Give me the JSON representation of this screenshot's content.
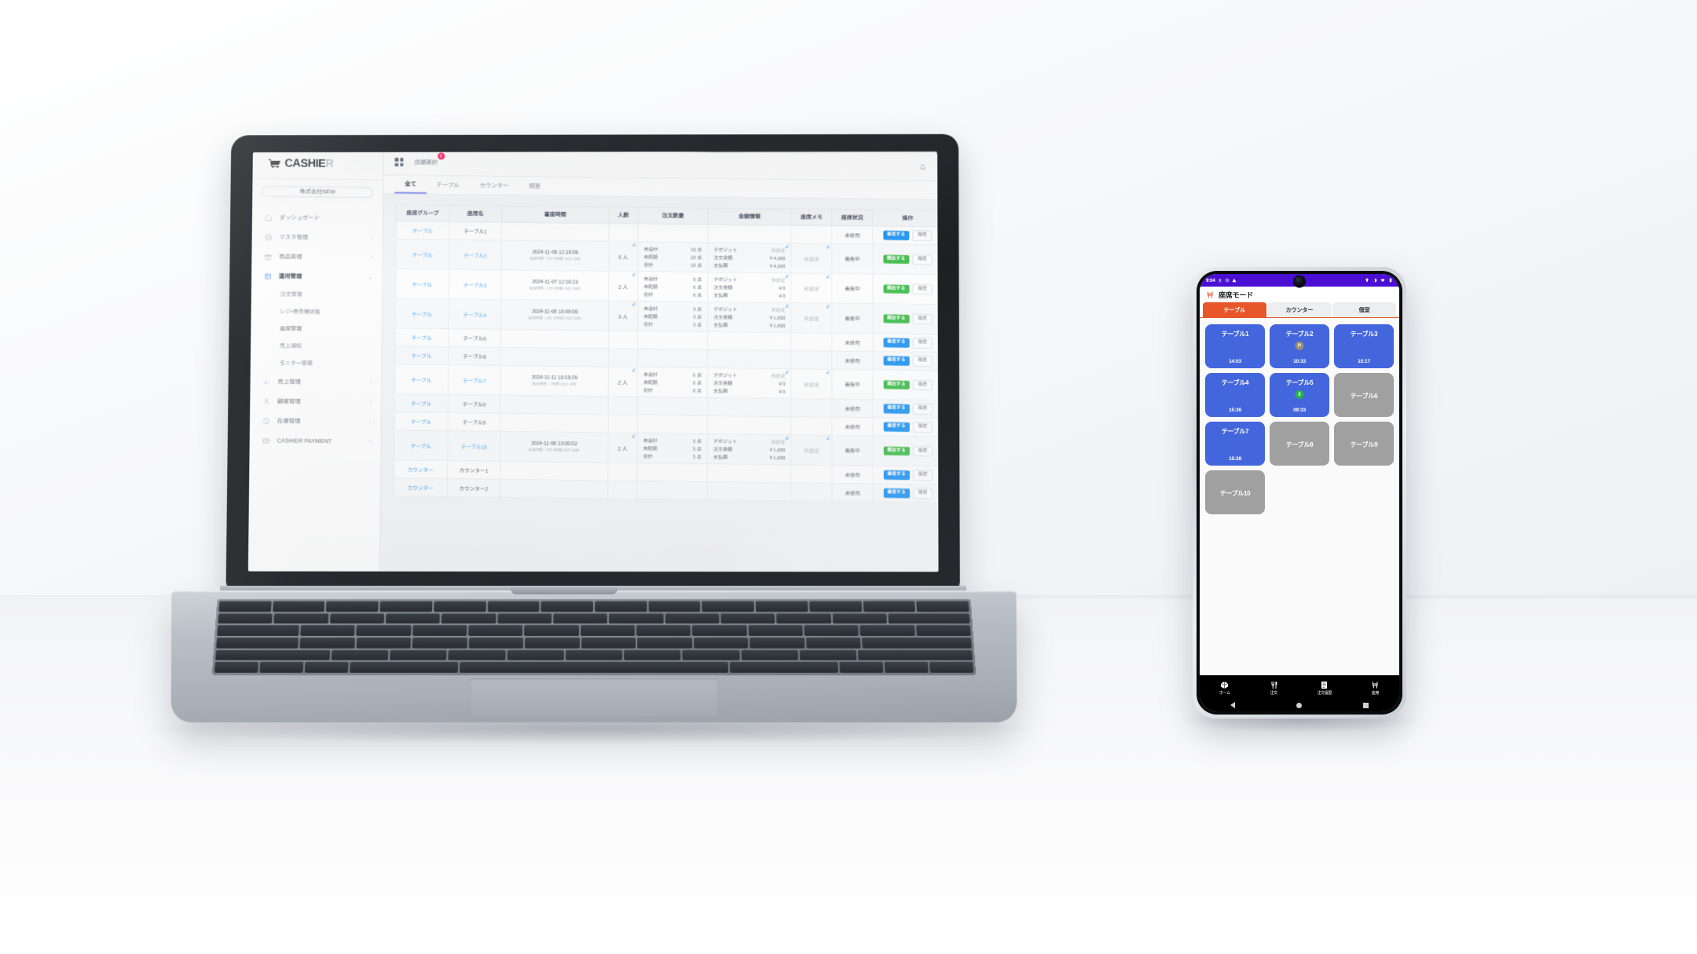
{
  "desktop": {
    "brand": {
      "name_bold": "CASHIE",
      "name_dim": "R",
      "logo_icon": "shopping-cart-icon"
    },
    "company_selector": "株式会社NEW",
    "topbar": {
      "apps_icon": "grid-apps-icon",
      "shop_select_label": "店舗選択",
      "shop_select_badge": "3",
      "bell_icon": "bell-icon",
      "gear_icon": "gear-icon"
    },
    "sidebar": {
      "items": [
        {
          "label": "ダッシュボード",
          "icon": "home-icon",
          "chevron": "",
          "active": false
        },
        {
          "label": "マスタ管理",
          "icon": "database-icon",
          "chevron": "›",
          "active": false
        },
        {
          "label": "商品管理",
          "icon": "box-icon",
          "chevron": "›",
          "active": false
        },
        {
          "label": "運用管理",
          "icon": "window-icon",
          "chevron": "⌄",
          "active": true
        }
      ],
      "sub_items": [
        {
          "label": "注文管理"
        },
        {
          "label": "レジ・券売機状態"
        },
        {
          "label": "座席管理"
        },
        {
          "label": "売上通知"
        },
        {
          "label": "モニター管理"
        }
      ],
      "items_lower": [
        {
          "label": "売上管理",
          "icon": "chart-icon",
          "chevron": "›"
        },
        {
          "label": "顧客管理",
          "icon": "user-icon",
          "chevron": "›"
        },
        {
          "label": "在庫管理",
          "icon": "clock-icon",
          "chevron": "›"
        },
        {
          "label": "CASHIER PAYMENT",
          "icon": "card-icon",
          "chevron": "›"
        }
      ]
    },
    "tabs": [
      {
        "label": "全て",
        "active": true
      },
      {
        "label": "テーブル",
        "active": false
      },
      {
        "label": "カウンター",
        "active": false
      },
      {
        "label": "個室",
        "active": false
      }
    ],
    "table": {
      "headers": [
        "座席グループ",
        "座席名",
        "着座時間",
        "人数",
        "注文数量",
        "金額情報",
        "座席メモ",
        "座席状況",
        "操作"
      ],
      "qty_labels": [
        "未会計",
        "未配膳",
        "合計"
      ],
      "amount_labels": [
        "デポジット",
        "注文金額",
        "支払額"
      ],
      "unit_points": "点",
      "rows": [
        {
          "group": "テーブル",
          "name": "テーブル1",
          "time": "",
          "time_sub": "",
          "people": "",
          "qty": [],
          "amount": [],
          "memo": "",
          "status": "未使用",
          "action_primary": "着席する",
          "action_primary_color": "blue",
          "action_secondary": "履歴"
        },
        {
          "group": "テーブル",
          "name": "テーブル2",
          "time": "2024-11-06 12:19:06",
          "time_sub": "経過時間：5日 6時間 16分 55秒",
          "people": "5 人",
          "qty": [
            "10 点",
            "10 点",
            "10 点"
          ],
          "amount": [
            "未設定",
            "￥4,900",
            "￥4,900"
          ],
          "memo": "未設定",
          "status": "着座中",
          "action_primary": "開放する",
          "action_primary_color": "green",
          "action_secondary": "履歴"
        },
        {
          "group": "テーブル",
          "name": "テーブル3",
          "time": "2024-11-07 12:16:23",
          "time_sub": "経過時間：4日 6時間 19分 38秒",
          "people": "2 人",
          "qty": [
            "0 点",
            "0 点",
            "0 点"
          ],
          "amount": [
            "未設定",
            "￥0",
            "￥0"
          ],
          "memo": "未設定",
          "status": "着座中",
          "action_primary": "開放する",
          "action_primary_color": "green",
          "action_secondary": "履歴"
        },
        {
          "group": "テーブル",
          "name": "テーブル4",
          "time": "2024-11-08 18:49:00",
          "time_sub": "経過時間：2日 23時間 46分 50秒",
          "people": "3 人",
          "qty": [
            "3 点",
            "3 点",
            "3 点"
          ],
          "amount": [
            "未設定",
            "￥1,600",
            "￥1,600"
          ],
          "memo": "未設定",
          "status": "着座中",
          "action_primary": "開放する",
          "action_primary_color": "green",
          "action_secondary": "履歴"
        },
        {
          "group": "テーブル",
          "name": "テーブル5",
          "time": "",
          "time_sub": "",
          "people": "",
          "qty": [],
          "amount": [],
          "memo": "",
          "status": "未使用",
          "action_primary": "着席する",
          "action_primary_color": "blue",
          "action_secondary": "履歴"
        },
        {
          "group": "テーブル",
          "name": "テーブル6",
          "time": "",
          "time_sub": "",
          "people": "",
          "qty": [],
          "amount": [],
          "memo": "",
          "status": "未使用",
          "action_primary": "着席する",
          "action_primary_color": "blue",
          "action_secondary": "履歴"
        },
        {
          "group": "テーブル",
          "name": "テーブル7",
          "time": "2024-11-11 10:19:29",
          "time_sub": "経過時間：1時間 16分 20秒",
          "people": "2 人",
          "qty": [
            "0 点",
            "0 点",
            "0 点"
          ],
          "amount": [
            "未設定",
            "￥0",
            "￥0"
          ],
          "memo": "未設定",
          "status": "着座中",
          "action_primary": "開放する",
          "action_primary_color": "green",
          "action_secondary": "履歴"
        },
        {
          "group": "テーブル",
          "name": "テーブル8",
          "time": "",
          "time_sub": "",
          "people": "",
          "qty": [],
          "amount": [],
          "memo": "",
          "status": "未使用",
          "action_primary": "着席する",
          "action_primary_color": "blue",
          "action_secondary": "履歴"
        },
        {
          "group": "テーブル",
          "name": "テーブル9",
          "time": "",
          "time_sub": "",
          "people": "",
          "qty": [],
          "amount": [],
          "memo": "",
          "status": "未使用",
          "action_primary": "着席する",
          "action_primary_color": "blue",
          "action_secondary": "履歴"
        },
        {
          "group": "テーブル",
          "name": "テーブル10",
          "time": "2024-11-06 13:00:52",
          "time_sub": "経過時間：5日 5時間 34分 58秒",
          "people": "2 人",
          "qty": [
            "3 点",
            "3 点",
            "3 点"
          ],
          "amount": [
            "未設定",
            "￥1,600",
            "￥1,600"
          ],
          "memo": "未設定",
          "status": "着座中",
          "action_primary": "開放する",
          "action_primary_color": "green",
          "action_secondary": "履歴"
        },
        {
          "group": "カウンター",
          "name": "カウンター1",
          "time": "",
          "time_sub": "",
          "people": "",
          "qty": [],
          "amount": [],
          "memo": "",
          "status": "未使用",
          "action_primary": "着席する",
          "action_primary_color": "blue",
          "action_secondary": "履歴"
        },
        {
          "group": "カウンター",
          "name": "カウンター2",
          "time": "",
          "time_sub": "",
          "people": "",
          "qty": [],
          "amount": [],
          "memo": "",
          "status": "未使用",
          "action_primary": "着席する",
          "action_primary_color": "blue",
          "action_secondary": "履歴"
        }
      ]
    }
  },
  "phone": {
    "statusbar": {
      "time": "9:04",
      "left_icons": [
        "download-icon",
        "sync-icon",
        "warning-icon"
      ],
      "right_icons": [
        "location-icon",
        "dnd-icon",
        "wifi-icon",
        "battery-icon"
      ]
    },
    "app_title": "座席モード",
    "app_title_icon": "chair-icon",
    "segments": [
      {
        "label": "テーブル",
        "active": true
      },
      {
        "label": "カウンター",
        "active": false
      },
      {
        "label": "個室",
        "active": false
      }
    ],
    "seats": [
      {
        "name": "テーブル1",
        "state": "occupied",
        "time": "14:03",
        "dot": ""
      },
      {
        "name": "テーブル2",
        "state": "occupied",
        "time": "10:33",
        "dot": "P"
      },
      {
        "name": "テーブル3",
        "state": "occupied",
        "time": "15:17",
        "dot": ""
      },
      {
        "name": "テーブル4",
        "state": "occupied",
        "time": "15:36",
        "dot": ""
      },
      {
        "name": "テーブル5",
        "state": "occupied",
        "time": "09:33",
        "dot": "¥"
      },
      {
        "name": "テーブル6",
        "state": "free",
        "time": "",
        "dot": ""
      },
      {
        "name": "テーブル7",
        "state": "occupied",
        "time": "15:28",
        "dot": ""
      },
      {
        "name": "テーブル8",
        "state": "free",
        "time": "",
        "dot": ""
      },
      {
        "name": "テーブル9",
        "state": "free",
        "time": "",
        "dot": ""
      },
      {
        "name": "テーブル10",
        "state": "free",
        "time": "",
        "dot": ""
      }
    ],
    "bottom_nav": [
      {
        "label": "ホーム",
        "icon": "home-cube-icon"
      },
      {
        "label": "注文",
        "icon": "cutlery-icon"
      },
      {
        "label": "注文履歴",
        "icon": "list-icon"
      },
      {
        "label": "座席",
        "icon": "chair-icon"
      }
    ],
    "system_nav": [
      "back-triangle-icon",
      "home-circle-icon",
      "recents-square-icon"
    ]
  },
  "colors": {
    "accent_blue": "#2196f3",
    "accent_green": "#3fbf4a",
    "badge_pink": "#ff1f6b",
    "phone_status_purple": "#4b0fd4",
    "phone_tab_orange": "#e8572a",
    "seat_occupied": "#4466dd",
    "seat_free": "#a0a0a0",
    "tab_underline": "#7b86f0"
  }
}
